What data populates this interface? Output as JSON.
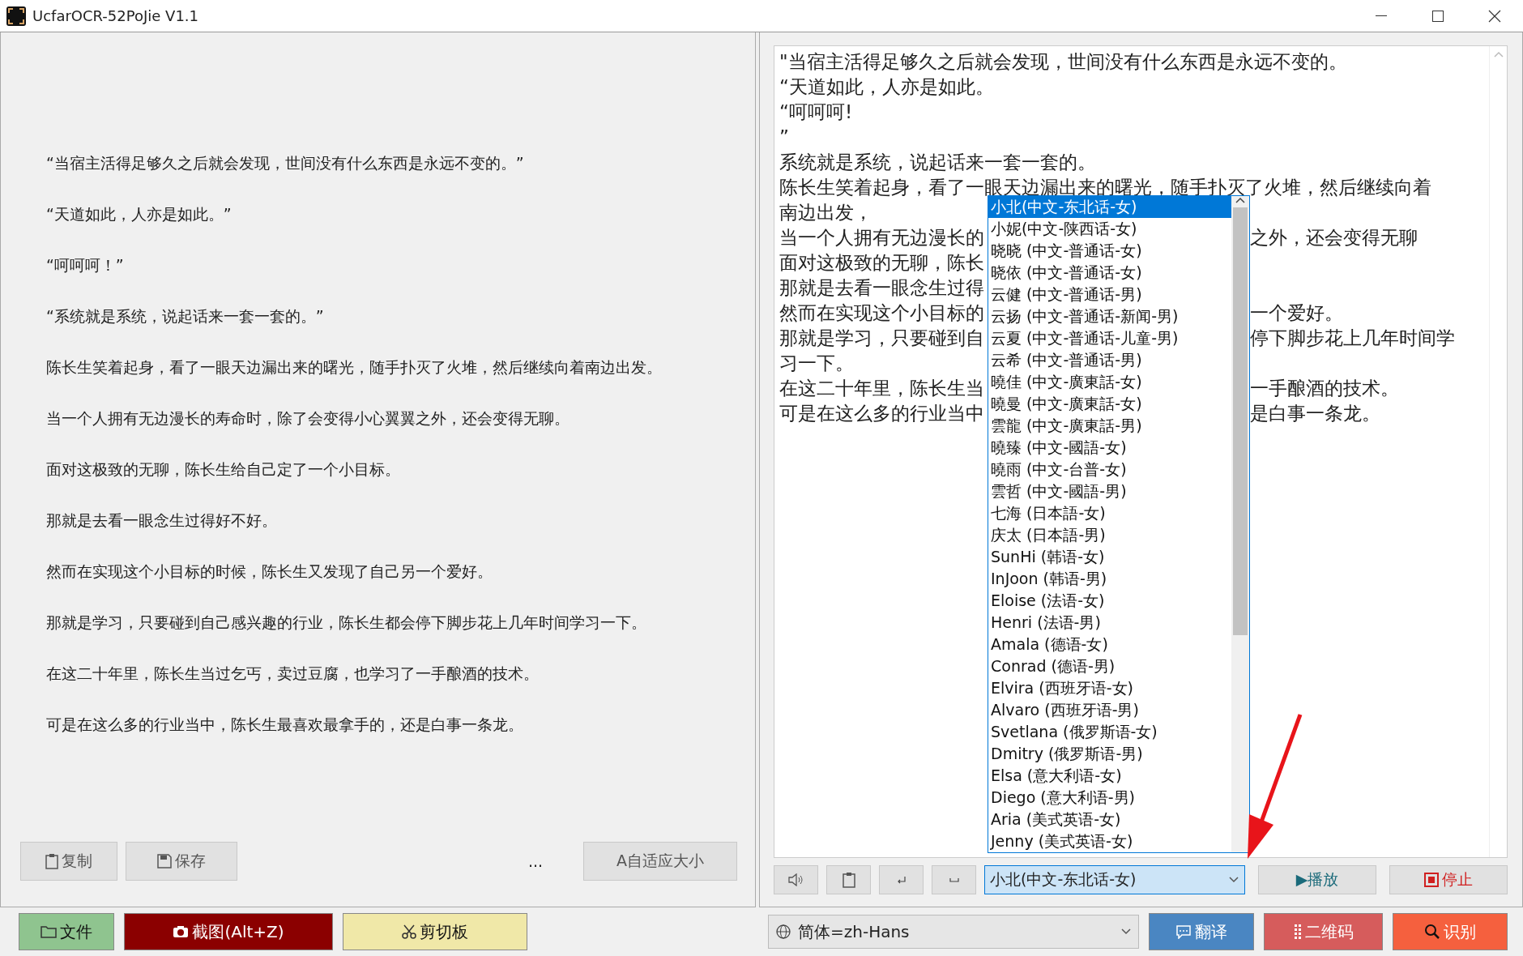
{
  "window": {
    "title": "UcfarOCR-52PoJie V1.1"
  },
  "source_text": {
    "paragraphs": [
      "“当宿主活得足够久之后就会发现，世间没有什么东西是永远不变的。”",
      "“天道如此，人亦是如此。”",
      "“呵呵呵！”",
      "“系统就是系统，说起话来一套一套的。”",
      "陈长生笑着起身，看了一眼天边漏出来的曙光，随手扑灭了火堆，然后继续向着南边出发。",
      "当一个人拥有无边漫长的寿命时，除了会变得小心翼翼之外，还会变得无聊。",
      "面对这极致的无聊，陈长生给自己定了一个小目标。",
      "那就是去看一眼念生过得好不好。",
      "然而在实现这个小目标的时候，陈长生又发现了自己另一个爱好。",
      "那就是学习，只要碰到自己感兴趣的行业，陈长生都会停下脚步花上几年时间学习一下。",
      "在这二十年里，陈长生当过乞丐，卖过豆腐，也学习了一手酿酒的技术。",
      "可是在这么多的行业当中，陈长生最喜欢最拿手的，还是白事一条龙。"
    ]
  },
  "left_buttons": {
    "copy": "复制",
    "save": "保存",
    "more": "...",
    "autofit": "A自适应大小"
  },
  "result_text": {
    "lines": [
      {
        "left": "\"当宿主活得足够久之后就会发现，世间没有什么东西是永远不变的。"
      },
      {
        "left": "“天道如此，人亦是如此。"
      },
      {
        "left": "“呵呵呵!"
      },
      {
        "left": "”"
      },
      {
        "left": "系统就是系统，说起话来一套一套的。"
      },
      {
        "left": "陈长生笑着起身，看了一眼天边漏出来的曙光，随手扑灭了火堆，然后继续向着"
      },
      {
        "left": "南边出发，"
      },
      {
        "left": "当一个人拥有无边漫长的",
        "right": "之外，还会变得无聊"
      },
      {
        "left": "面对这极致的无聊，陈长"
      },
      {
        "left": "那就是去看一眼念生过得"
      },
      {
        "left": "然而在实现这个小目标的",
        "right": "一个爱好。"
      },
      {
        "left": "那就是学习，只要碰到自",
        "right": "停下脚步花上几年时间学"
      },
      {
        "left": "习一下。"
      },
      {
        "left": "在这二十年里，陈长生当",
        "right": "一手酿酒的技术。"
      },
      {
        "left": "可是在这么多的行业当中",
        "right": "是白事一条龙。"
      }
    ]
  },
  "voice": {
    "value": "小北(中文-东北话-女)",
    "expanded": true,
    "options": [
      {
        "label": "小北(中文-东北话-女)",
        "selected": true
      },
      {
        "label": "小妮(中文-陕西话-女)",
        "selected": false
      },
      {
        "label": "晓晓 (中文-普通话-女)",
        "selected": false
      },
      {
        "label": "晓依 (中文-普通话-女)",
        "selected": false
      },
      {
        "label": "云健 (中文-普通话-男)",
        "selected": false
      },
      {
        "label": "云扬 (中文-普通话-新闻-男)",
        "selected": false
      },
      {
        "label": "云夏 (中文-普通话-儿童-男)",
        "selected": false
      },
      {
        "label": "云希 (中文-普通话-男)",
        "selected": false
      },
      {
        "label": "曉佳 (中文-廣東話-女)",
        "selected": false
      },
      {
        "label": "曉曼 (中文-廣東話-女)",
        "selected": false
      },
      {
        "label": "雲龍 (中文-廣東話-男)",
        "selected": false
      },
      {
        "label": "曉臻 (中文-國語-女)",
        "selected": false
      },
      {
        "label": "曉雨 (中文-台普-女)",
        "selected": false
      },
      {
        "label": "雲哲 (中文-國語-男)",
        "selected": false
      },
      {
        "label": "七海 (日本語-女)",
        "selected": false
      },
      {
        "label": "庆太 (日本語-男)",
        "selected": false
      },
      {
        "label": "SunHi (韩语-女)",
        "selected": false
      },
      {
        "label": "InJoon (韩语-男)",
        "selected": false
      },
      {
        "label": "Eloise (法语-女)",
        "selected": false
      },
      {
        "label": "Henri (法语-男)",
        "selected": false
      },
      {
        "label": "Amala (德语-女)",
        "selected": false
      },
      {
        "label": "Conrad (德语-男)",
        "selected": false
      },
      {
        "label": "Elvira (西班牙语-女)",
        "selected": false
      },
      {
        "label": "Alvaro (西班牙语-男)",
        "selected": false
      },
      {
        "label": "Svetlana (俄罗斯语-女)",
        "selected": false
      },
      {
        "label": "Dmitry (俄罗斯语-男)",
        "selected": false
      },
      {
        "label": "Elsa (意大利语-女)",
        "selected": false
      },
      {
        "label": "Diego (意大利语-男)",
        "selected": false
      },
      {
        "label": "Aria (美式英语-女)",
        "selected": false
      },
      {
        "label": "Jenny (美式英语-女)",
        "selected": false
      }
    ]
  },
  "play_button": "▶播放",
  "stop_button": "停止",
  "bottom_bar": {
    "left_buttons": [
      {
        "label": "文件",
        "color": "#8fc48f"
      },
      {
        "label": "截图(Alt+Z)",
        "color": "#8b0000"
      },
      {
        "label": "剪切板",
        "color": "#f0e8a8"
      }
    ],
    "language": "简体=zh-Hans",
    "right_buttons": [
      {
        "label": "翻译",
        "color": "#4a86c2"
      },
      {
        "label": "二维码",
        "color": "#d65c5c"
      },
      {
        "label": "识别",
        "color": "#f5603e"
      }
    ]
  }
}
